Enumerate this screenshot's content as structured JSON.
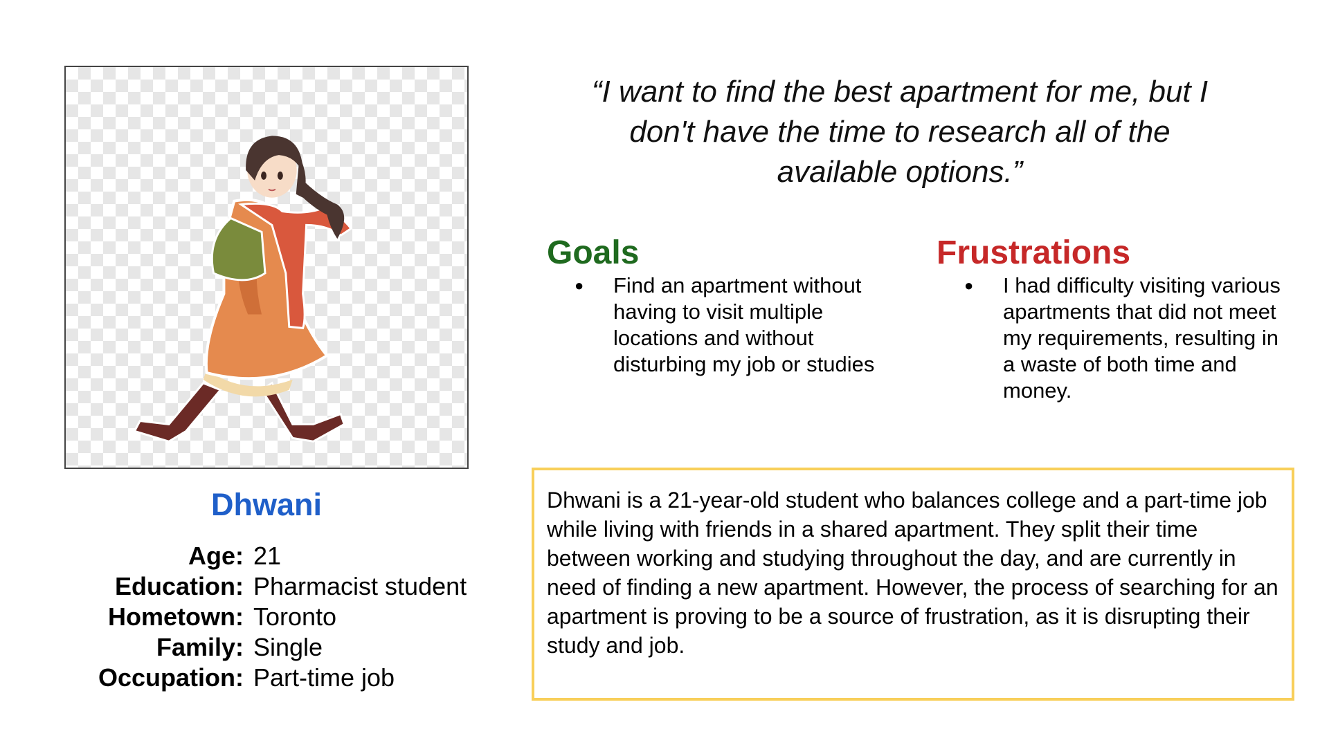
{
  "persona": {
    "name": "Dhwani",
    "image_alt": "Illustration of a girl in an orange coat and red scarf walking"
  },
  "details": [
    {
      "label": "Age:",
      "value": "21"
    },
    {
      "label": "Education:",
      "value": "Pharmacist student"
    },
    {
      "label": "Hometown:",
      "value": "Toronto"
    },
    {
      "label": "Family:",
      "value": "Single"
    },
    {
      "label": "Occupation:",
      "value": "Part-time job"
    }
  ],
  "quote": {
    "line1": "“I want to find the best apartment for me, but I",
    "line2": "don't have the time to research all of the",
    "line3": "available options.”"
  },
  "goals": {
    "heading": "Goals",
    "items": [
      "Find an apartment without having to visit multiple locations and without disturbing my job or studies"
    ]
  },
  "frustrations": {
    "heading": "Frustrations",
    "items": [
      "I had difficulty visiting various apartments that did not meet my requirements, resulting in a waste of both time and money."
    ]
  },
  "bio": {
    "text": "Dhwani is a 21-year-old student who balances college and a part-time job while living with friends in a shared apartment. They split their time between working and studying throughout the day, and are currently in need of finding a new apartment. However, the process of searching for an apartment is proving to be a source of frustration, as it is disrupting their study and job."
  },
  "colors": {
    "name": "#1f5fc9",
    "goals": "#1f6a1f",
    "frustrations": "#c62828",
    "bio_border": "#f8cf5a"
  }
}
